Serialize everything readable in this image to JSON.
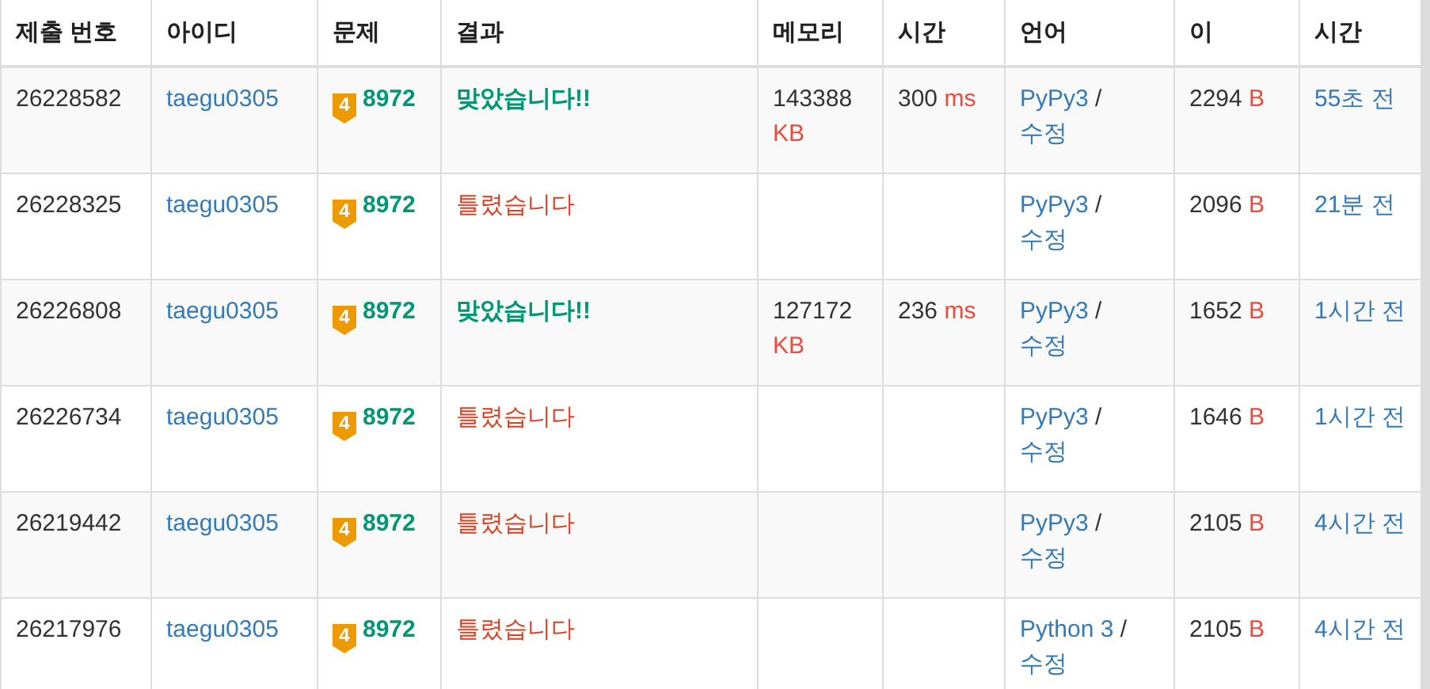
{
  "table": {
    "columns": [
      {
        "label": "제출 번호"
      },
      {
        "label": "아이디"
      },
      {
        "label": "문제"
      },
      {
        "label": "결과"
      },
      {
        "label": "메모리"
      },
      {
        "label": "시간"
      },
      {
        "label": "언어"
      },
      {
        "label": "이"
      },
      {
        "label": "시간"
      }
    ],
    "rows": [
      {
        "id": "26228582",
        "user": "taegu0305",
        "tier": "4",
        "problem": "8972",
        "result": {
          "kind": "accepted",
          "text": "맞았습니다!!"
        },
        "memory": {
          "value": "143388",
          "unit": "KB"
        },
        "time": {
          "value": "300",
          "unit": "ms"
        },
        "language": "PyPy3",
        "separator": "/",
        "edit": "수정",
        "length": {
          "value": "2294",
          "unit": "B"
        },
        "submitted": "55초 전"
      },
      {
        "id": "26228325",
        "user": "taegu0305",
        "tier": "4",
        "problem": "8972",
        "result": {
          "kind": "wrong",
          "text": "틀렸습니다"
        },
        "language": "PyPy3",
        "separator": "/",
        "edit": "수정",
        "length": {
          "value": "2096",
          "unit": "B"
        },
        "submitted": "21분 전"
      },
      {
        "id": "26226808",
        "user": "taegu0305",
        "tier": "4",
        "problem": "8972",
        "result": {
          "kind": "accepted",
          "text": "맞았습니다!!"
        },
        "memory": {
          "value": "127172",
          "unit": "KB"
        },
        "time": {
          "value": "236",
          "unit": "ms"
        },
        "language": "PyPy3",
        "separator": "/",
        "edit": "수정",
        "length": {
          "value": "1652",
          "unit": "B"
        },
        "submitted": "1시간 전"
      },
      {
        "id": "26226734",
        "user": "taegu0305",
        "tier": "4",
        "problem": "8972",
        "result": {
          "kind": "wrong",
          "text": "틀렸습니다"
        },
        "language": "PyPy3",
        "separator": "/",
        "edit": "수정",
        "length": {
          "value": "1646",
          "unit": "B"
        },
        "submitted": "1시간 전"
      },
      {
        "id": "26219442",
        "user": "taegu0305",
        "tier": "4",
        "problem": "8972",
        "result": {
          "kind": "wrong",
          "text": "틀렸습니다"
        },
        "language": "PyPy3",
        "separator": "/",
        "edit": "수정",
        "length": {
          "value": "2105",
          "unit": "B"
        },
        "submitted": "4시간 전"
      },
      {
        "id": "26217976",
        "user": "taegu0305",
        "tier": "4",
        "problem": "8972",
        "result": {
          "kind": "wrong",
          "text": "틀렸습니다"
        },
        "language": "Python 3",
        "separator": "/",
        "edit": "수정",
        "length": {
          "value": "2105",
          "unit": "B"
        },
        "submitted": "4시간 전"
      }
    ]
  }
}
